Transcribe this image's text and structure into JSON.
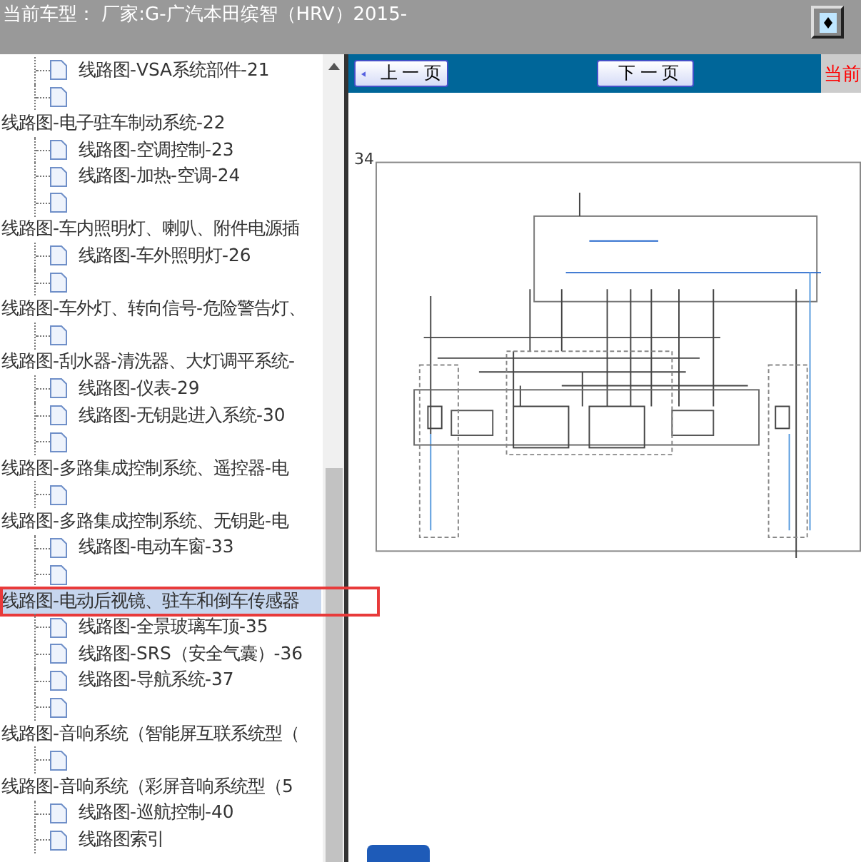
{
  "header": {
    "title": "当前车型：  厂家:G-广汽本田缤智（HRV）2015-"
  },
  "tree": {
    "leading_items": [
      {
        "label": "线路图-VSA系统部件-21",
        "selected": false
      },
      {
        "selected": false
      }
    ],
    "groups": [
      {
        "label": "线路图-电子驻车制动系统-22",
        "selected": false,
        "children": [
          {
            "label": "线路图-空调控制-23",
            "selected": false
          },
          {
            "label": "线路图-加热-空调-24",
            "selected": false
          },
          {
            "selected": false
          }
        ]
      },
      {
        "label": "线路图-车内照明灯、喇叭、附件电源插",
        "selected": false,
        "children": [
          {
            "label": "线路图-车外照明灯-26",
            "selected": false
          },
          {
            "selected": false
          }
        ]
      },
      {
        "label": "线路图-车外灯、转向信号-危险警告灯、",
        "selected": false,
        "children": [
          {
            "selected": false
          }
        ]
      },
      {
        "label": "线路图-刮水器-清洗器、大灯调平系统-",
        "selected": false,
        "children": [
          {
            "label": "线路图-仪表-29",
            "selected": false
          },
          {
            "label": "线路图-无钥匙进入系统-30",
            "selected": false
          },
          {
            "selected": false
          }
        ]
      },
      {
        "label": "线路图-多路集成控制系统、遥控器-电",
        "selected": false,
        "children": [
          {
            "selected": false
          }
        ]
      },
      {
        "label": "线路图-多路集成控制系统、无钥匙-电",
        "selected": false,
        "children": [
          {
            "label": "线路图-电动车窗-33",
            "selected": false
          },
          {
            "selected": false
          }
        ]
      },
      {
        "label": "线路图-电动后视镜、驻车和倒车传感器",
        "selected": true,
        "children": [
          {
            "label": "线路图-全景玻璃车顶-35",
            "selected": false
          },
          {
            "label": "线路图-SRS（安全气囊）-36",
            "selected": false
          },
          {
            "label": "线路图-导航系统-37",
            "selected": false
          },
          {
            "selected": false
          }
        ]
      },
      {
        "label": "线路图-音响系统（智能屏互联系统型（",
        "selected": false,
        "children": [
          {
            "selected": false
          }
        ]
      },
      {
        "label": "线路图-音响系统（彩屏音响系统型（5",
        "selected": false,
        "children": [
          {
            "label": "线路图-巡航控制-40",
            "selected": false
          },
          {
            "label": "线路图索引",
            "selected": false
          }
        ]
      }
    ]
  },
  "nav": {
    "prev": "上 一 页",
    "next": "下 一 页",
    "current": "当前"
  },
  "page": {
    "number": "34"
  }
}
